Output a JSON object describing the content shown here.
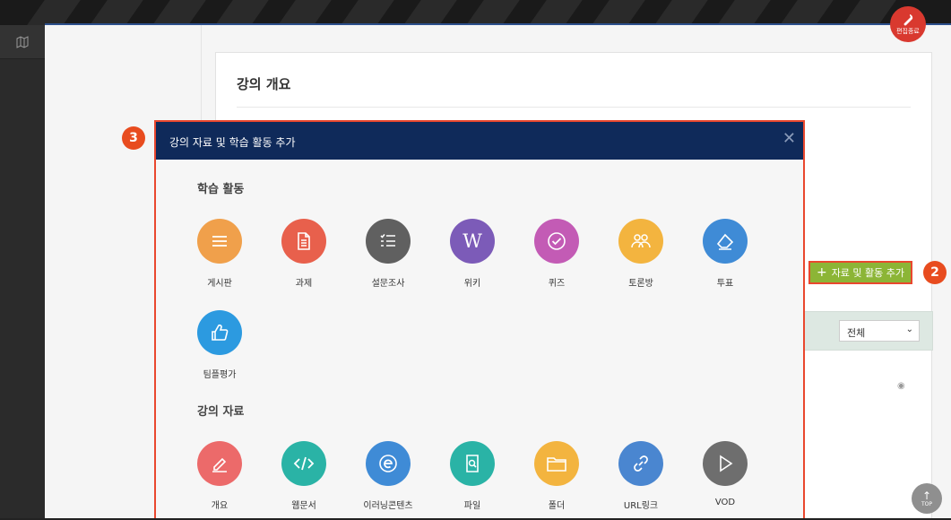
{
  "sidebar": {
    "icon": "map-icon"
  },
  "header": {
    "edit_label": "편집종료",
    "edit_icon": "wrench-icon"
  },
  "course": {
    "section_title": "강의 개요"
  },
  "actions": {
    "add_button_label": "자료 및 활동 추가",
    "add_button_color": "#8cb536"
  },
  "filter": {
    "selected": "전체"
  },
  "annotations": {
    "badge_2": "2",
    "badge_3": "3",
    "badge_color": "#e84c1f",
    "highlight_color": "#e9472e"
  },
  "modal": {
    "title": "강의 자료 및 학습 활동 추가",
    "header_color": "#0f2a5a",
    "close_icon": "close-icon",
    "activities_title": "학습 활동",
    "resources_title": "강의 자료",
    "activities": [
      {
        "label": "게시판",
        "icon": "list-icon",
        "color": "#f0a04b"
      },
      {
        "label": "과제",
        "icon": "document-icon",
        "color": "#e8604c"
      },
      {
        "label": "설문조사",
        "icon": "checklist-icon",
        "color": "#606060"
      },
      {
        "label": "위키",
        "icon": "wiki-icon",
        "color": "#7c5bb8"
      },
      {
        "label": "퀴즈",
        "icon": "check-circle-icon",
        "color": "#c35bb5"
      },
      {
        "label": "토론방",
        "icon": "people-icon",
        "color": "#f3b43f"
      },
      {
        "label": "투표",
        "icon": "eraser-icon",
        "color": "#3f8bd6"
      },
      {
        "label": "팀플평가",
        "icon": "thumbs-up-icon",
        "color": "#2c9ae0"
      }
    ],
    "resources": [
      {
        "label": "개요",
        "icon": "pencil-icon",
        "color": "#ec6a6a"
      },
      {
        "label": "웹문서",
        "icon": "code-icon",
        "color": "#2ab3a6"
      },
      {
        "label": "이러닝콘텐츠",
        "icon": "e-icon",
        "color": "#3f8bd6"
      },
      {
        "label": "파일",
        "icon": "file-search-icon",
        "color": "#2ab3a6"
      },
      {
        "label": "폴더",
        "icon": "folder-icon",
        "color": "#f3b43f"
      },
      {
        "label": "URL링크",
        "icon": "link-icon",
        "color": "#4a86d0"
      },
      {
        "label": "VOD",
        "icon": "play-icon",
        "color": "#6e6e6e"
      }
    ]
  },
  "scroll_top": {
    "label": "TOP"
  }
}
